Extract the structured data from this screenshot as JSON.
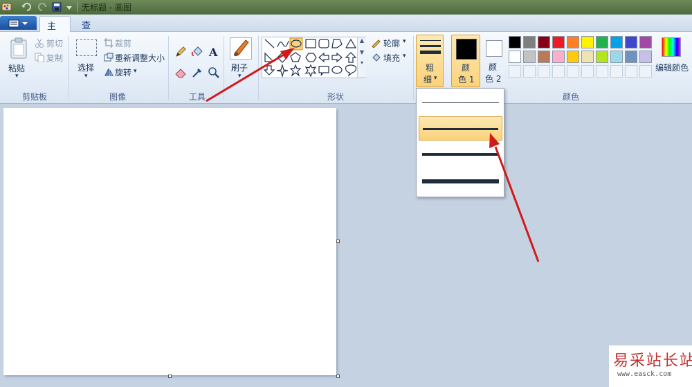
{
  "window": {
    "title": "无标题 - 画图"
  },
  "tabs": [
    {
      "label": "主页",
      "active": true
    },
    {
      "label": "查看",
      "active": false
    }
  ],
  "clipboard": {
    "paste": "粘贴",
    "cut": "剪切",
    "copy": "复制",
    "group": "剪贴板"
  },
  "image": {
    "select": "选择",
    "crop": "裁剪",
    "resize": "重新调整大小",
    "rotate": "旋转",
    "group": "图像"
  },
  "tools": {
    "group": "工具",
    "brush": "刷子"
  },
  "shapes": {
    "outline": "轮廓",
    "fill": "填充",
    "group": "形状"
  },
  "size": {
    "label_line1": "粗",
    "label_line2": "细"
  },
  "colors": {
    "color1_line1": "颜",
    "color1_line2": "色 1",
    "color2_line1": "颜",
    "color2_line2": "色 2",
    "edit": "编辑颜色",
    "group": "颜色",
    "color1_value": "#000000",
    "color2_value": "#ffffff",
    "palette_row1": [
      "#000000",
      "#7f7f7f",
      "#880015",
      "#ed1c24",
      "#ff7f27",
      "#fff200",
      "#22b14c",
      "#00a2e8",
      "#3f48cc",
      "#a349a4"
    ],
    "palette_row2": [
      "#ffffff",
      "#c3c3c3",
      "#b97a57",
      "#ffaec9",
      "#ffc90e",
      "#efe4b0",
      "#b5e61d",
      "#99d9ea",
      "#7092be",
      "#c8bfe7"
    ]
  },
  "size_options": {
    "selected_index": 1,
    "count": 4
  },
  "watermark": {
    "text": "易采站长站",
    "url": "www.easck.com"
  },
  "accent": {
    "highlight": "#fbd27a",
    "arrow": "#d11a1a"
  }
}
